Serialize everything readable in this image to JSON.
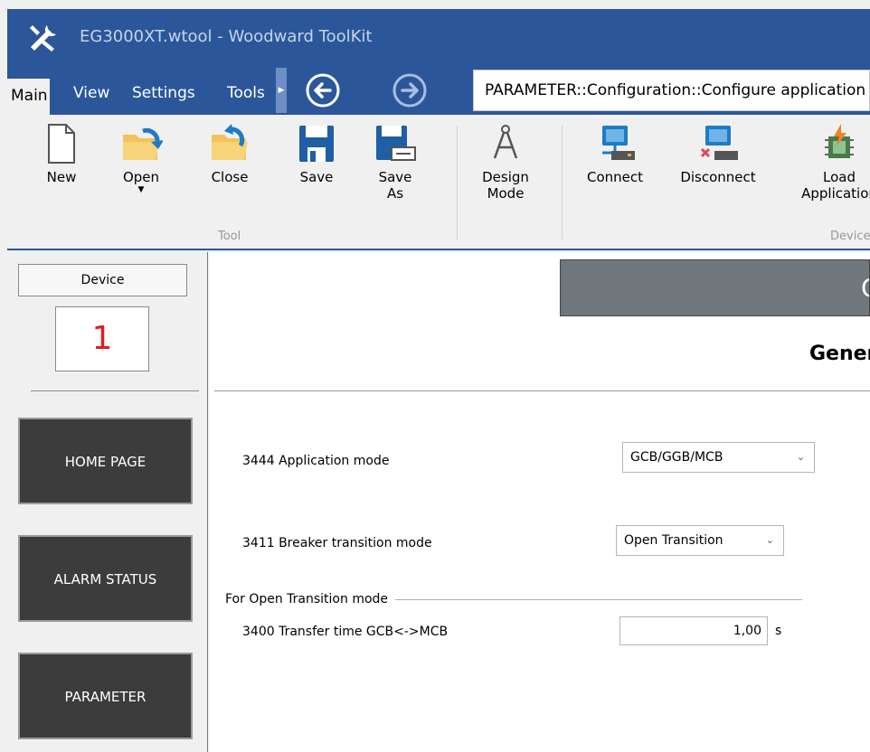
{
  "window": {
    "title": "EG3000XT.wtool - Woodward ToolKit",
    "app_icon": "tools-icon"
  },
  "menu": {
    "tabs": [
      "Main",
      "View",
      "Settings",
      "Tools"
    ],
    "back_icon": "arrow-left-circle-icon",
    "forward_icon": "arrow-right-circle-icon",
    "address": "PARAMETER::Configuration::Configure application"
  },
  "ribbon": {
    "buttons": {
      "new": "New",
      "open": "Open",
      "close": "Close",
      "save": "Save",
      "save_as_line1": "Save",
      "save_as_line2": "As",
      "design_mode_line1": "Design",
      "design_mode_line2": "Mode",
      "connect": "Connect",
      "disconnect": "Disconnect",
      "load_app_line1": "Load",
      "load_app_line2": "Application"
    },
    "groups": {
      "tool": "Tool",
      "device": "Device"
    }
  },
  "sidebar": {
    "device_label": "Device",
    "device_number": "1",
    "nav": [
      "HOME PAGE",
      "ALARM STATUS",
      "PARAMETER"
    ]
  },
  "main": {
    "header_text": "C",
    "section_title": "General",
    "params": {
      "app_mode": {
        "label": "3444 Application mode",
        "value": "GCB/GGB/MCB"
      },
      "breaker_mode": {
        "label": "3411 Breaker transition mode",
        "value": "Open Transition"
      },
      "open_group": "For Open Transition mode",
      "transfer_time": {
        "label": "3400 Transfer time GCB<->MCB",
        "value": "1,00",
        "unit": "s"
      }
    }
  },
  "colors": {
    "title_blue": "#2b579a",
    "device_number_red": "#e21d1d",
    "nav_button_dark": "#3c3c3c",
    "header_gray": "#6f777d"
  }
}
